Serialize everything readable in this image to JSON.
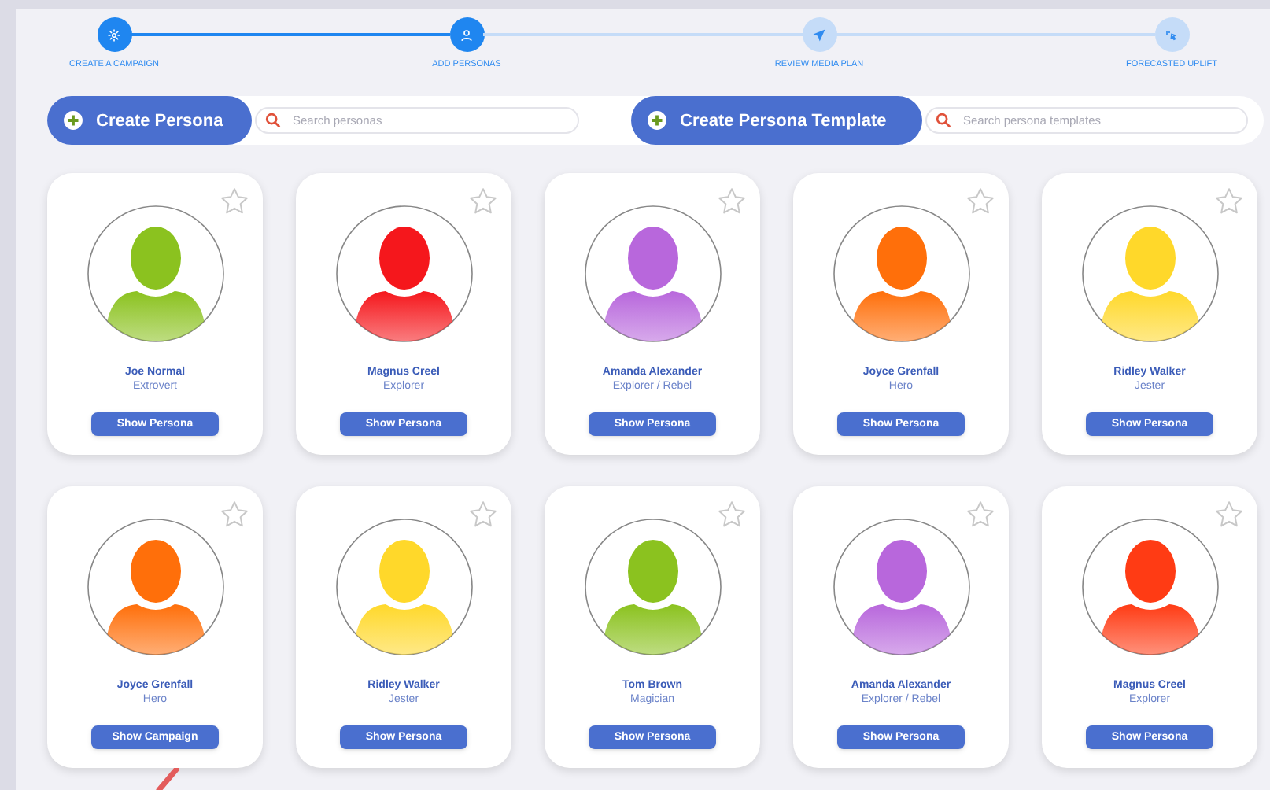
{
  "steps": [
    {
      "label": "CREATE A CAMPAIGN",
      "completed": true
    },
    {
      "label": "ADD PERSONAS",
      "completed": true
    },
    {
      "label": "REVIEW MEDIA PLAN",
      "completed": false
    },
    {
      "label": "FORECASTED UPLIFT",
      "completed": false
    }
  ],
  "toolbar": {
    "create_persona": "Create Persona",
    "persona_search": {
      "placeholder": "Search personas"
    },
    "create_template": "Create Persona Template",
    "template_search": {
      "placeholder": "Search persona templates"
    }
  },
  "personas": [
    {
      "name": "Joe Normal",
      "type": "Extrovert",
      "button": "Show Persona",
      "color": "#8bc21f",
      "starred": false
    },
    {
      "name": "Magnus Creel",
      "type": "Explorer",
      "button": "Show Persona",
      "color": "#f5171c",
      "starred": false
    },
    {
      "name": "Amanda Alexander",
      "type": "Explorer / Rebel",
      "button": "Show Persona",
      "color": "#b867dc",
      "starred": false
    },
    {
      "name": "Joyce Grenfall",
      "type": "Hero",
      "button": "Show Persona",
      "color": "#ff6f0a",
      "starred": false
    },
    {
      "name": "Ridley Walker",
      "type": "Jester",
      "button": "Show Persona",
      "color": "#ffd82a",
      "starred": false
    },
    {
      "name": "Joyce Grenfall",
      "type": "Hero",
      "button": "Show Campaign",
      "color": "#ff6f0a",
      "starred": false
    },
    {
      "name": "Ridley Walker",
      "type": "Jester",
      "button": "Show Persona",
      "color": "#ffd82a",
      "starred": false
    },
    {
      "name": "Tom Brown",
      "type": "Magician",
      "button": "Show Persona",
      "color": "#8bc21f",
      "starred": false
    },
    {
      "name": "Amanda Alexander",
      "type": "Explorer / Rebel",
      "button": "Show Persona",
      "color": "#b867dc",
      "starred": false
    },
    {
      "name": "Magnus Creel",
      "type": "Explorer",
      "button": "Show Persona",
      "color": "#ff3b14",
      "starred": false
    }
  ]
}
